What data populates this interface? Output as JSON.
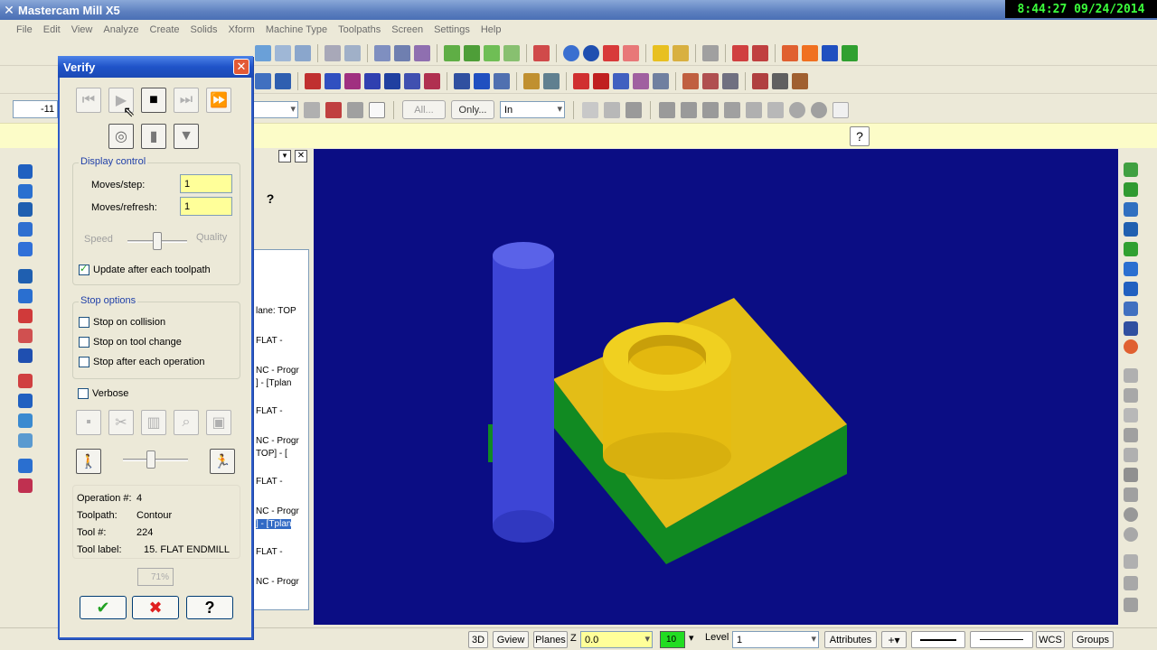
{
  "app": {
    "title": "Mastercam Mill X5",
    "clock": "8:44:27  09/24/2014"
  },
  "menu": [
    "File",
    "Edit",
    "View",
    "Analyze",
    "Create",
    "Solids",
    "Xform",
    "Machine Type",
    "Toolpaths",
    "Screen",
    "Settings",
    "Help"
  ],
  "toolbar": {
    "all_label": "All...",
    "only_label": "Only...",
    "units": "In",
    "partial_value": "-11"
  },
  "ops_list": [
    "lane: TOP",
    "FLAT -",
    "NC - Progr",
    "] - [Tplan",
    "FLAT -",
    "NC - Progr",
    "TOP] - [",
    "FLAT -",
    "NC - Progr",
    "] - [Tplan",
    "FLAT -",
    "NC - Progr"
  ],
  "verify": {
    "title": "Verify",
    "display_control": "Display control",
    "moves_step_label": "Moves/step:",
    "moves_step_value": "1",
    "moves_refresh_label": "Moves/refresh:",
    "moves_refresh_value": "1",
    "speed_label": "Speed",
    "quality_label": "Quality",
    "update_label": "Update after each toolpath",
    "stop_options": "Stop options",
    "stop_collision": "Stop on collision",
    "stop_tool_change": "Stop on tool change",
    "stop_each_op": "Stop after each operation",
    "verbose": "Verbose",
    "info": {
      "op_label": "Operation #:",
      "op_value": "4",
      "toolpath_label": "Toolpath:",
      "toolpath_value": "Contour",
      "tool_label": "Tool #:",
      "tool_value": "224",
      "tool_label_label": "Tool label:",
      "tool_label_value": "15. FLAT ENDMILL"
    },
    "progress": "71%"
  },
  "status": {
    "btn_3d": "3D",
    "gview": "Gview",
    "planes": "Planes",
    "z_label": "Z",
    "z_value": "0.0",
    "color_value": "10",
    "level_label": "Level",
    "level_value": "1",
    "attributes": "Attributes",
    "wcs": "WCS",
    "groups": "Groups"
  },
  "colors": {
    "viewport_bg": "#0b0d84",
    "stock_yellow": "#e8c21a",
    "stock_green": "#118a22",
    "tool_blue": "#3d45d6",
    "title_blue": "#1f53c8"
  }
}
